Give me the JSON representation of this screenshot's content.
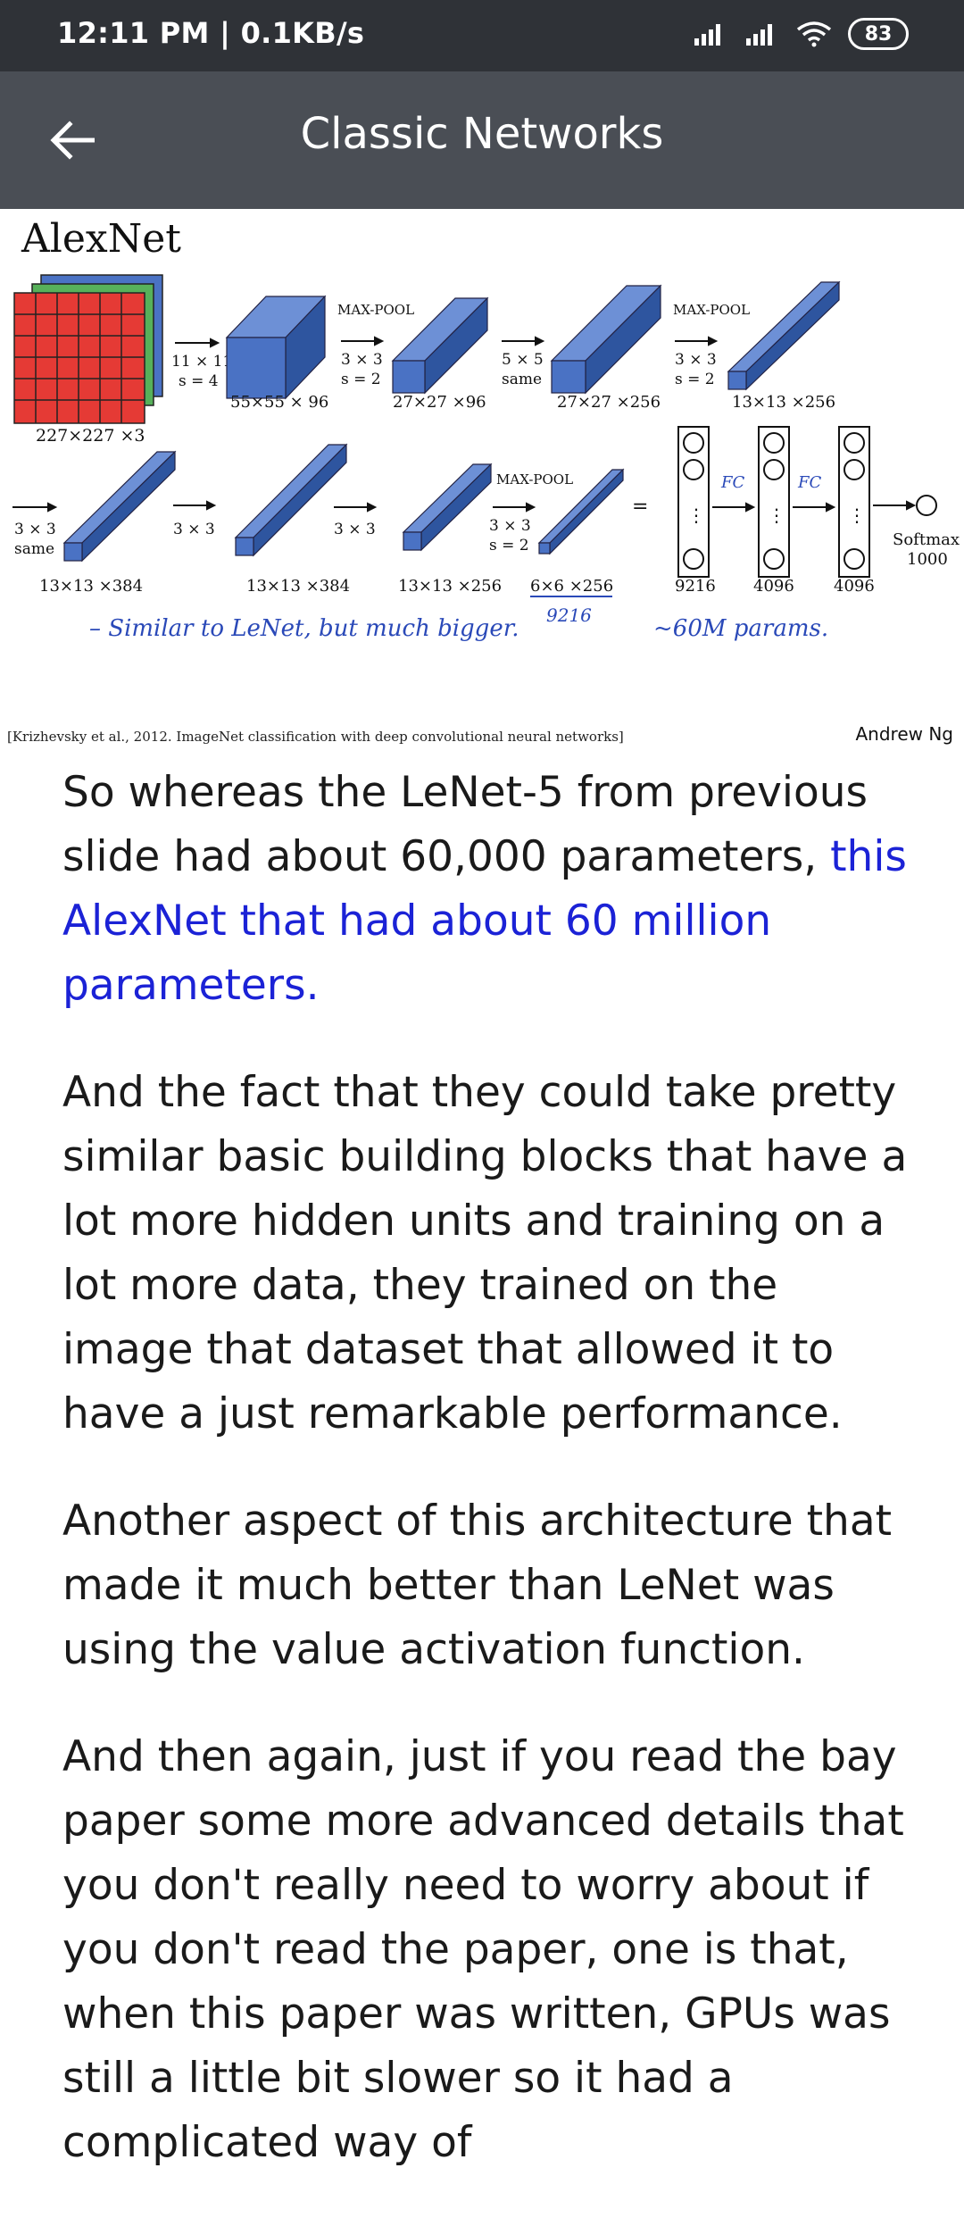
{
  "status": {
    "time_net": "12:11 PM | 0.1KB/s",
    "battery": "83"
  },
  "header": {
    "title": "Classic Networks"
  },
  "slide": {
    "heading": "AlexNet",
    "labels": {
      "input_dims": "227×227 ×3",
      "conv1_kernel": "11 × 11",
      "conv1_stride": "s = 4",
      "conv1_out": "55×55 × 96",
      "maxpool": "MAX-POOL",
      "pool1_kernel": "3 × 3",
      "pool1_stride": "s = 2",
      "pool1_out": "27×27 ×96",
      "conv2_kernel": "5 × 5",
      "conv2_pad": "same",
      "conv2_out": "27×27 ×256",
      "pool2_kernel": "3 × 3",
      "pool2_stride": "s = 2",
      "pool2_out": "13×13 ×256",
      "conv3_kernel": "3 × 3",
      "conv3_pad": "same",
      "conv3_out": "13×13 ×384",
      "conv4_kernel": "3 × 3",
      "conv4_out": "13×13 ×384",
      "conv5_kernel": "3 × 3",
      "conv5_out": "13×13 ×256",
      "pool3_kernel": "3 × 3",
      "pool3_stride": "s = 2",
      "pool3_out": "6×6 ×256",
      "flatten_count": "9216",
      "fc1": "4096",
      "fc2": "4096",
      "softmax": "Softmax",
      "softmax_count": "1000",
      "equals": "=",
      "vdots": "⋮"
    },
    "handwriting": {
      "note_left": "– Similar to LeNet, but much bigger.",
      "note_9216": "9216",
      "note_params": "~60M params.",
      "fc_label": "FC"
    },
    "citation": "[Krizhevsky et al., 2012. ImageNet classification with deep convolutional neural networks]",
    "author": "Andrew Ng"
  },
  "transcript": {
    "p1_text": "So whereas the LeNet-5 from previous slide had about 60,000 parameters,",
    "p1_highlight": "this AlexNet that had about 60 million parameters.",
    "p2": "And the fact that they could take pretty similar basic building blocks that have a lot more hidden units and training on a lot more data, they trained on the image that dataset that allowed it to have a just remarkable performance.",
    "p3": "Another aspect of this architecture that made it much better than LeNet was using the value activation function.",
    "p4": "And then again, just if you read the bay paper some more advanced details that you don't really need to worry about if you don't read the paper, one is that, when this paper was written, GPUs was still a little bit slower so it had a complicated way of"
  },
  "colors": {
    "statusbar": "#2f3237",
    "appbar": "#4a4e55",
    "highlight": "#1b22d6",
    "block_front": "#4a72c4",
    "block_top": "#6d90d6",
    "block_side": "#2e559f",
    "ink": "#2a49b8"
  }
}
